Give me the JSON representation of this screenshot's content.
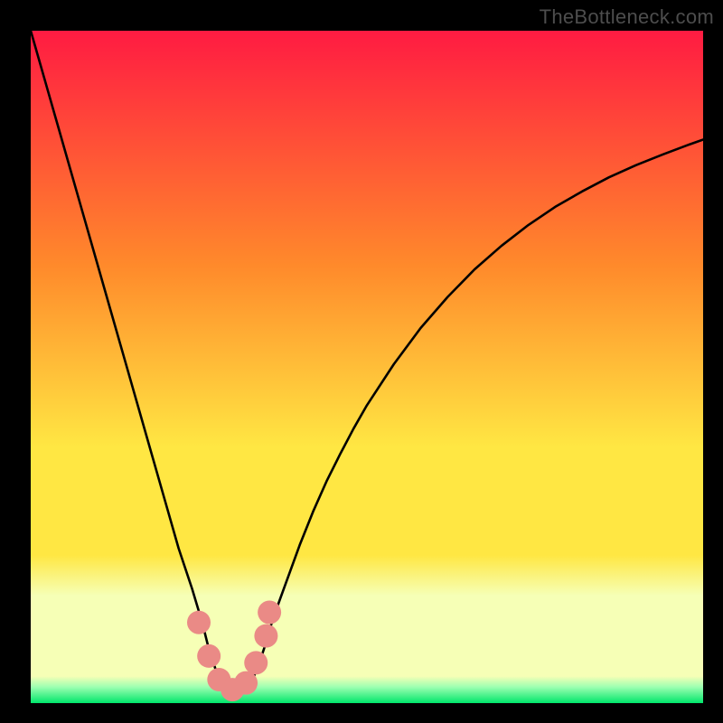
{
  "credit_text": "TheBottleneck.com",
  "colors": {
    "top": "#ff1b42",
    "mid_orange": "#ff8a2b",
    "mid_yellow": "#ffe743",
    "pale": "#f6ffb6",
    "light_gr": "#9dffb1",
    "green": "#00e66b",
    "curve": "#000000",
    "nodes": "#ea8a86",
    "bg": "#000000",
    "credit": "#4d4d4d"
  },
  "chart_data": {
    "type": "line",
    "title": "",
    "xlabel": "",
    "ylabel": "",
    "xlim": [
      0,
      100
    ],
    "ylim": [
      0,
      100
    ],
    "x": [
      0,
      2,
      4,
      6,
      8,
      10,
      12,
      14,
      16,
      18,
      20,
      22,
      24,
      25.5,
      26.5,
      27.5,
      28.5,
      29.3,
      30,
      31,
      32,
      33,
      34,
      35,
      36,
      38,
      40,
      42,
      44,
      46,
      48,
      50,
      54,
      58,
      62,
      66,
      70,
      74,
      78,
      82,
      86,
      90,
      94,
      98,
      100
    ],
    "series": [
      {
        "name": "bottleneck-curve",
        "values": [
          100,
          93,
          86,
          79,
          72,
          65,
          58,
          51,
          44,
          37,
          30,
          23,
          17,
          12,
          8,
          5,
          3,
          2,
          1.5,
          1.5,
          2,
          3.5,
          6,
          9,
          12.5,
          18,
          23.5,
          28.5,
          33,
          37,
          40.8,
          44.3,
          50.4,
          55.8,
          60.4,
          64.5,
          68,
          71.1,
          73.8,
          76.1,
          78.2,
          80,
          81.6,
          83.1,
          83.8
        ]
      }
    ],
    "annotations": {
      "blob_points": [
        {
          "x": 25.0,
          "y": 12.0
        },
        {
          "x": 26.5,
          "y": 7.0
        },
        {
          "x": 28.0,
          "y": 3.5
        },
        {
          "x": 30.0,
          "y": 2.0
        },
        {
          "x": 32.0,
          "y": 3.0
        },
        {
          "x": 33.5,
          "y": 6.0
        },
        {
          "x": 35.0,
          "y": 10.0
        },
        {
          "x": 35.5,
          "y": 13.5
        }
      ],
      "green_band_top_y": 4.0
    }
  }
}
